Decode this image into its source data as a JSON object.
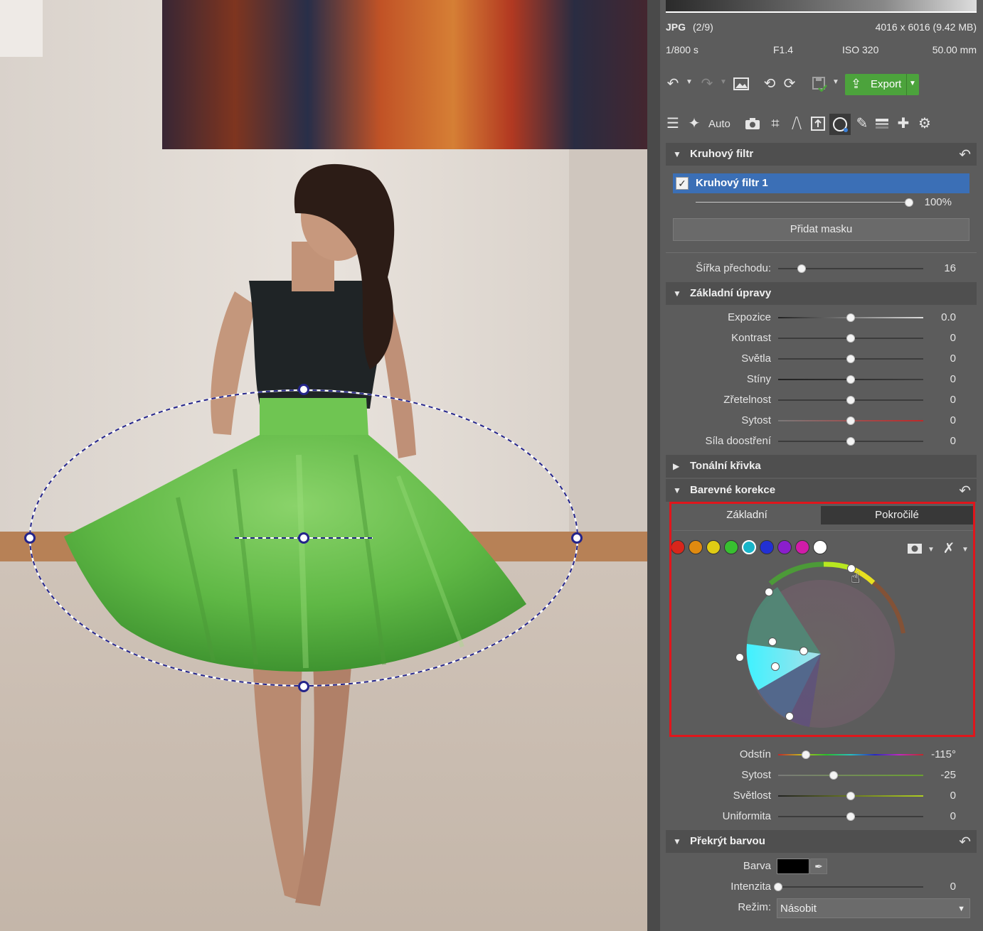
{
  "file_info": {
    "format": "JPG",
    "index": "(2/9)",
    "dimensions": "4016 x 6016 (9.42 MB)",
    "shutter": "1/800 s",
    "aperture": "F1.4",
    "iso": "ISO 320",
    "focal": "50.00 mm"
  },
  "toolbar": {
    "export_label": "Export",
    "auto_label": "Auto"
  },
  "sections": {
    "radial_filter": "Kruhový filtr",
    "basic": "Základní úpravy",
    "tone_curve": "Tonální křivka",
    "color_correction": "Barevné korekce",
    "color_overlay": "Překrýt barvou"
  },
  "filter": {
    "name": "Kruhový filtr 1",
    "checked": true,
    "opacity_value": "100%",
    "opacity": 1.0,
    "add_mask_label": "Přidat masku",
    "transition_label": "Šířka přechodu:",
    "transition_value": "16",
    "transition": 0.16
  },
  "basic_adjustments": [
    {
      "label": "Expozice",
      "value": "0.0",
      "pos": 0.5
    },
    {
      "label": "Kontrast",
      "value": "0",
      "pos": 0.5
    },
    {
      "label": "Světla",
      "value": "0",
      "pos": 0.5
    },
    {
      "label": "Stíny",
      "value": "0",
      "pos": 0.5
    },
    {
      "label": "Zřetelnost",
      "value": "0",
      "pos": 0.5
    },
    {
      "label": "Sytost",
      "value": "0",
      "pos": 0.5
    },
    {
      "label": "Síla doostření",
      "value": "0",
      "pos": 0.5
    }
  ],
  "color_tabs": {
    "basic": "Základní",
    "advanced": "Pokročilé"
  },
  "swatches": [
    "#d8261b",
    "#e08a10",
    "#e0cc14",
    "#38c030",
    "#18b4c8",
    "#2230d4",
    "#8a1ecc",
    "#d01ca8",
    "#ffffff"
  ],
  "color_adjustments": [
    {
      "label": "Odstín",
      "value": "-115°",
      "pos": 0.19
    },
    {
      "label": "Sytost",
      "value": "-25",
      "pos": 0.38
    },
    {
      "label": "Světlost",
      "value": "0",
      "pos": 0.5
    },
    {
      "label": "Uniformita",
      "value": "0",
      "pos": 0.5
    }
  ],
  "overlay": {
    "color_label": "Barva",
    "color": "#000000",
    "intensity_label": "Intenzita",
    "intensity_value": "0",
    "intensity": 0.0,
    "mode_label": "Režim:",
    "mode_value": "Násobit"
  }
}
